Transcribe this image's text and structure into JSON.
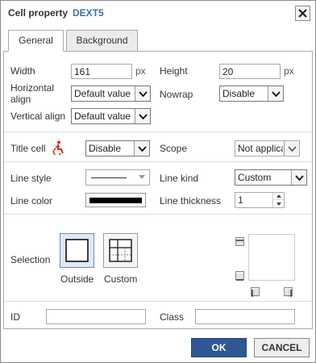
{
  "dialog": {
    "title": "Cell property",
    "brand": "DEXT5",
    "close_icon": "close-icon"
  },
  "tabs": [
    {
      "label": "General",
      "active": true
    },
    {
      "label": "Background",
      "active": false
    }
  ],
  "general": {
    "width_label": "Width",
    "width_value": "161",
    "width_unit": "px",
    "height_label": "Height",
    "height_value": "20",
    "height_unit": "px",
    "halign_label_1": "Horizontal",
    "halign_label_2": "align",
    "halign_value": "Default value",
    "nowrap_label": "Nowrap",
    "nowrap_value": "Disable",
    "valign_label": "Vertical align",
    "valign_value": "Default value",
    "titlecell_label": "Title cell",
    "titlecell_icon": "accessibility-icon",
    "titlecell_value": "Disable",
    "scope_label": "Scope",
    "scope_value": "Not applicable",
    "linestyle_label": "Line style",
    "linekind_label": "Line kind",
    "linekind_value": "Custom",
    "linecolor_label": "Line color",
    "linecolor_value": "#000000",
    "linethickness_label": "Line thickness",
    "linethickness_value": "1",
    "selection_label": "Selection",
    "selection_outside": "Outside",
    "selection_custom": "Custom",
    "id_label": "ID",
    "id_value": "",
    "class_label": "Class",
    "class_value": ""
  },
  "footer": {
    "ok_label": "OK",
    "cancel_label": "CANCEL"
  },
  "colors": {
    "brand": "#3a6ea5",
    "ok_button": "#2f5795"
  }
}
